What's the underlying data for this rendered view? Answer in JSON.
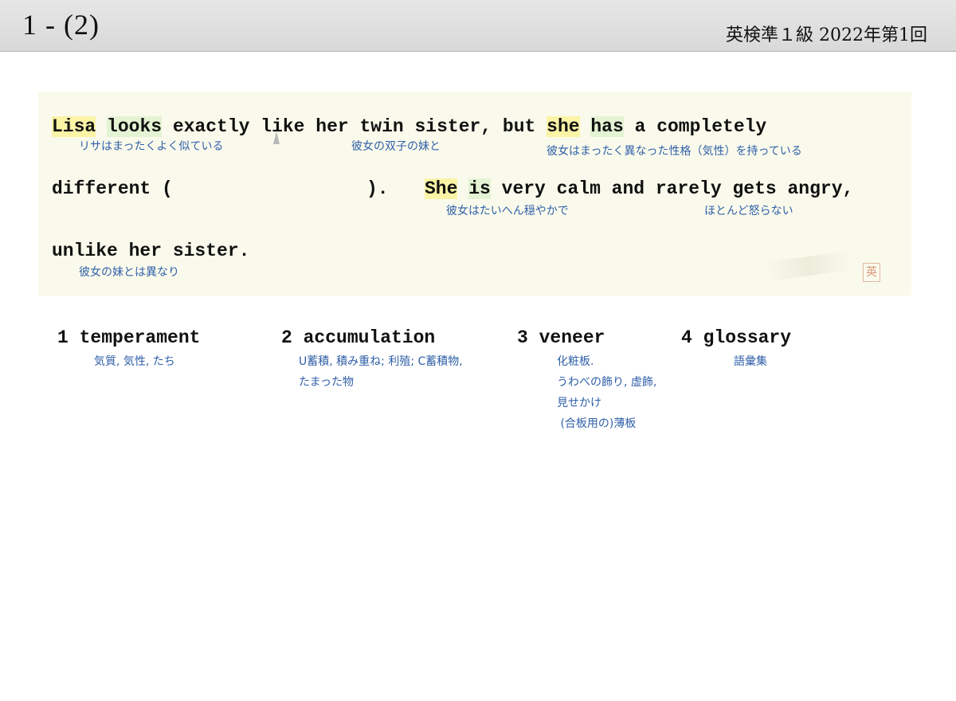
{
  "header": {
    "slide_number": "1 - (2)",
    "exam": "英検準１級  2022年第1回"
  },
  "passage": {
    "line1": {
      "w_lisa": "Lisa",
      "w_looks": "looks",
      "t_after_looks": " exactly like her twin sister, but ",
      "w_she": "she",
      "w_has": "has",
      "t_after_has": " a completely"
    },
    "line2": {
      "t_before_blank": "different (",
      "t_after_blank": ").",
      "w_she": "She",
      "w_is": "is",
      "t_rest": " very calm and rarely gets angry,"
    },
    "line3": {
      "text": "unlike her sister."
    },
    "glosses": {
      "g1": "リサはまったくよく似ている",
      "g2": "彼女の双子の妹と",
      "g3": "彼女はまったく異なった性格（気性）を持っている",
      "g4": "彼女はたいへん穏やかで",
      "g5": "ほとんど怒らない",
      "g6": "彼女の妹とは異なり"
    },
    "seal_char": "英"
  },
  "choices": [
    {
      "label": "1 temperament",
      "gloss": [
        "気質, 気性, たち"
      ]
    },
    {
      "label": "2 accumulation",
      "gloss": [
        "U蓄積, 積み重ね; 利殖; C蓄積物,",
        "たまった物"
      ]
    },
    {
      "label": "3 veneer",
      "gloss": [
        "化粧板.",
        "うわべの飾り, 虚飾,",
        "見せかけ",
        " (合板用の)薄板"
      ]
    },
    {
      "label": "4 glossary",
      "gloss": [
        "語彙集"
      ]
    }
  ]
}
